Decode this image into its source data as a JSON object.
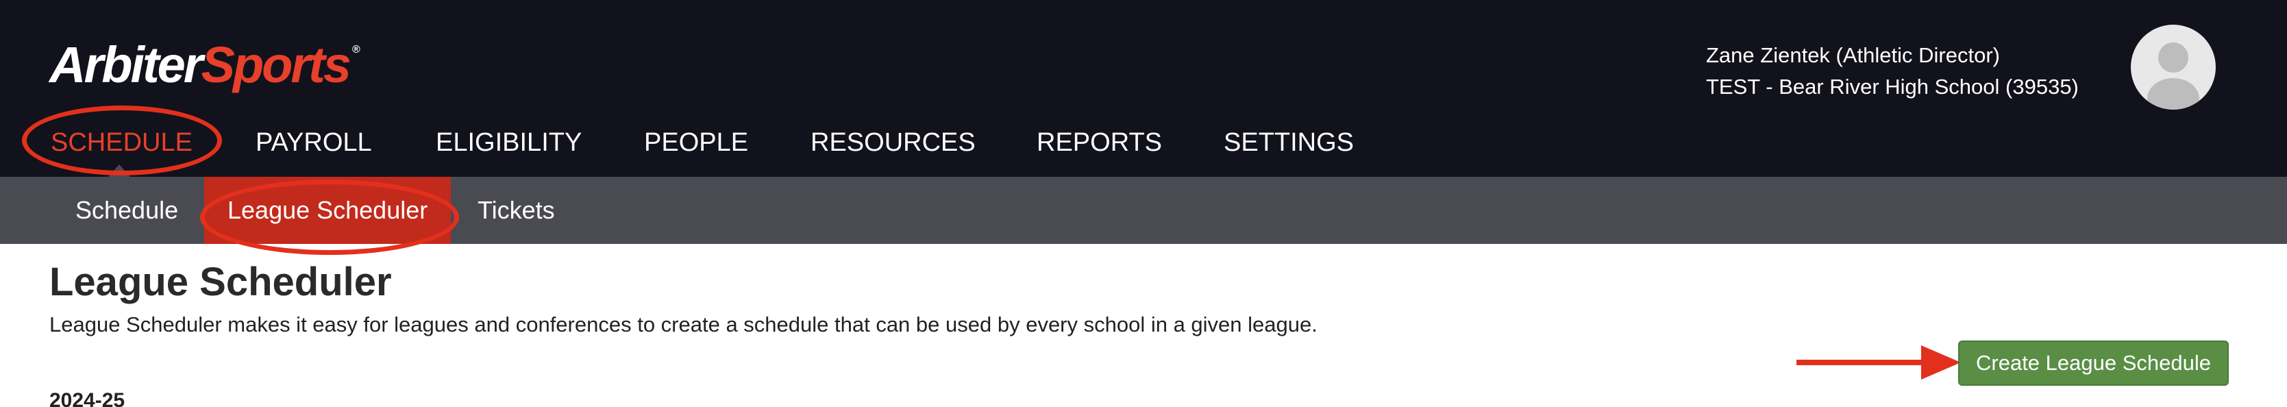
{
  "brand": {
    "logo_part1": "Arbiter",
    "logo_part2": "Sports",
    "logo_tm": "®"
  },
  "main_nav": {
    "items": [
      {
        "label": "SCHEDULE",
        "active": true
      },
      {
        "label": "PAYROLL"
      },
      {
        "label": "ELIGIBILITY"
      },
      {
        "label": "PEOPLE"
      },
      {
        "label": "RESOURCES"
      },
      {
        "label": "REPORTS"
      },
      {
        "label": "SETTINGS"
      }
    ]
  },
  "user": {
    "name_role": "Zane Zientek (Athletic Director)",
    "organization": "TEST - Bear River High School (39535)",
    "avatar_icon": "user-silhouette-icon"
  },
  "sub_nav": {
    "items": [
      {
        "label": "Schedule"
      },
      {
        "label": "League Scheduler",
        "active": true
      },
      {
        "label": "Tickets"
      }
    ]
  },
  "page": {
    "title": "League Scheduler",
    "description": "League Scheduler makes it easy for leagues and conferences to create a schedule that can be used by every school in a given league.",
    "season_label": "2024-25",
    "create_button_label": "Create League Schedule"
  },
  "colors": {
    "topbar_bg": "#12121c",
    "subbar_bg": "#4a4a52",
    "accent_red": "#e8402a",
    "annotation_red": "#e3301c",
    "button_green": "#5a8e45"
  }
}
